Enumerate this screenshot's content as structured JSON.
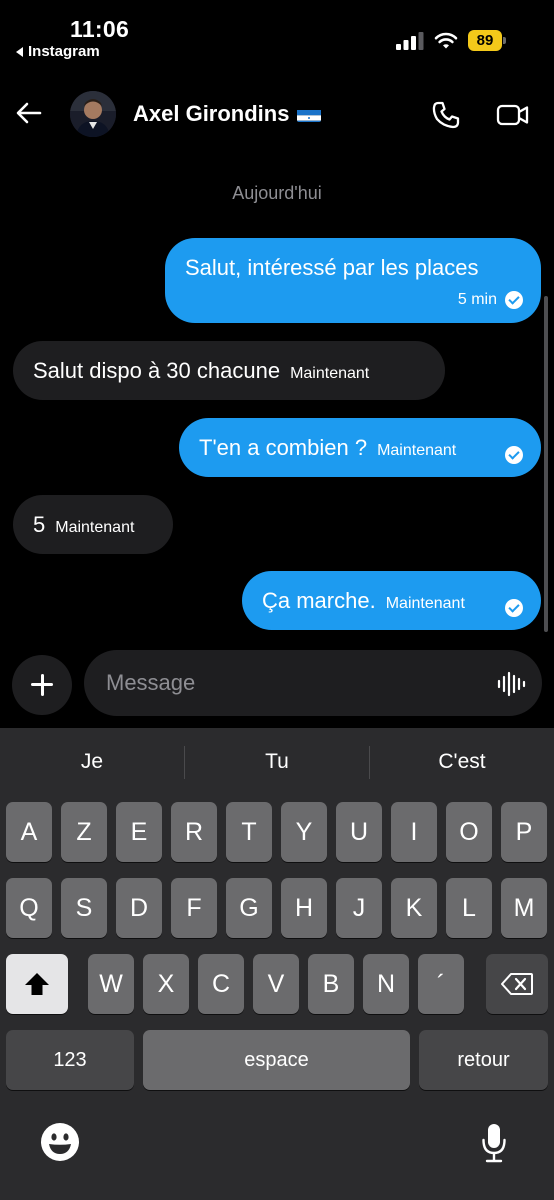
{
  "status_bar": {
    "time": "11:06",
    "back_app": "Instagram",
    "battery": "89",
    "battery_color": "#f4c91a"
  },
  "header": {
    "contact_name": "Axel Girondins",
    "flag_icon": "honduras-flag-icon",
    "back_icon": "arrow-left-icon",
    "call_icon": "phone-icon",
    "video_icon": "video-camera-icon"
  },
  "chat": {
    "date_separator": "Aujourd'hui",
    "outgoing_color": "#1d9bf0",
    "incoming_color": "#1e1e20",
    "messages": [
      {
        "direction": "out",
        "text": "Salut, intéressé par les places",
        "time": "5 min",
        "read": true
      },
      {
        "direction": "in",
        "text": "Salut dispo à 30 chacune",
        "time": "Maintenant"
      },
      {
        "direction": "out",
        "text": "T'en a combien ?",
        "time": "Maintenant",
        "read": true
      },
      {
        "direction": "in",
        "text": "5",
        "time": "Maintenant"
      },
      {
        "direction": "out",
        "text": "Ça marche.",
        "time": "Maintenant",
        "read": true
      }
    ]
  },
  "composer": {
    "placeholder": "Message",
    "add_icon": "plus-icon",
    "voice_icon": "waveform-icon"
  },
  "keyboard": {
    "suggestions": [
      "Je",
      "Tu",
      "C'est"
    ],
    "rows": [
      [
        "A",
        "Z",
        "E",
        "R",
        "T",
        "Y",
        "U",
        "I",
        "O",
        "P"
      ],
      [
        "Q",
        "S",
        "D",
        "F",
        "G",
        "H",
        "J",
        "K",
        "L",
        "M"
      ],
      [
        "W",
        "X",
        "C",
        "V",
        "B",
        "N",
        "´"
      ]
    ],
    "numbers_key": "123",
    "space_key": "espace",
    "return_key": "retour",
    "shift_icon": "shift-arrow-icon",
    "delete_icon": "delete-backspace-icon",
    "emoji_icon": "emoji-smiley-icon",
    "mic_icon": "microphone-icon"
  }
}
